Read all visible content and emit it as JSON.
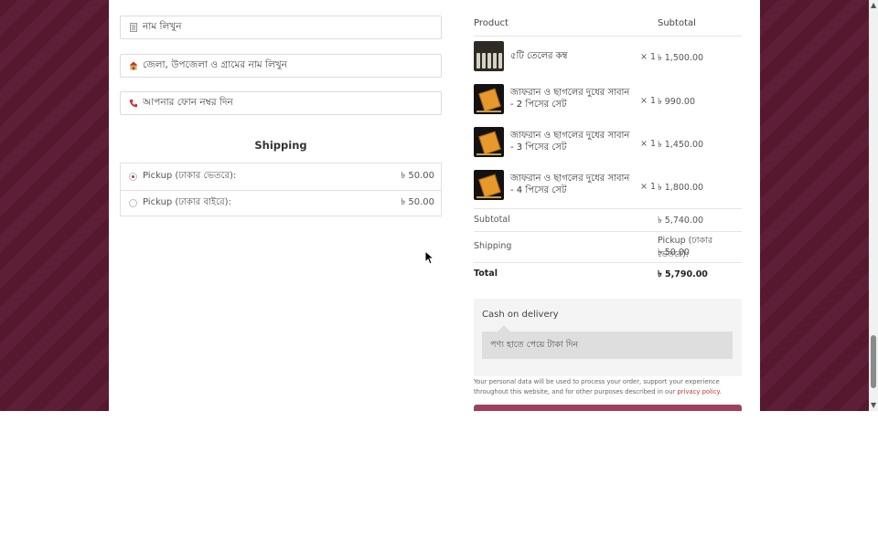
{
  "billing": {
    "name_placeholder": "নাম লিখুন",
    "address_placeholder": "জেলা, উপজেলা ও গ্রামের নাম লিখুন",
    "phone_placeholder": "আপনার ফোন নম্বর দিন"
  },
  "shipping": {
    "title": "Shipping",
    "options": [
      {
        "label": "Pickup (ঢাকার ভেতরে):",
        "price": "৳ 50.00",
        "selected": true
      },
      {
        "label": "Pickup (ঢাকার বাইরে):",
        "price": "৳ 50.00",
        "selected": false
      }
    ]
  },
  "order": {
    "col_product": "Product",
    "col_subtotal": "Subtotal",
    "items": [
      {
        "name": "৫টি তেলের কম্ব",
        "qty": "× 1",
        "subtotal": "৳ 1,500.00",
        "image": "oil-bottles"
      },
      {
        "name": "জাফরান ও ছাগলের দুধের সাবান - 2 পিসের সেট",
        "qty": "× 1",
        "subtotal": "৳ 990.00",
        "image": "soap"
      },
      {
        "name": "জাফরান ও ছাগলের দুধের সাবান - 3 পিসের সেট",
        "qty": "× 1",
        "subtotal": "৳ 1,450.00",
        "image": "soap"
      },
      {
        "name": "জাফরান ও ছাগলের দুধের সাবান - 4 পিসের সেট",
        "qty": "× 1",
        "subtotal": "৳ 1,800.00",
        "image": "soap"
      }
    ],
    "subtotal_label": "Subtotal",
    "subtotal_value": "৳ 5,740.00",
    "shipping_label": "Shipping",
    "shipping_method": "Pickup (ঢাকার ভেতরে):",
    "shipping_value": "৳ 50.00",
    "total_label": "Total",
    "total_value": "৳ 5,790.00"
  },
  "payment": {
    "method": "Cash on delivery",
    "description": "পণ্য হাতে পেয়ে টাকা দিন"
  },
  "privacy": {
    "text": "Your personal data will be used to process your order, support your experience throughout this website, and for other purposes described in our ",
    "link": "privacy policy",
    "end": "."
  },
  "colors": {
    "page_background": "#5c1a33",
    "accent": "#b23a4a",
    "button": "#a04060"
  }
}
